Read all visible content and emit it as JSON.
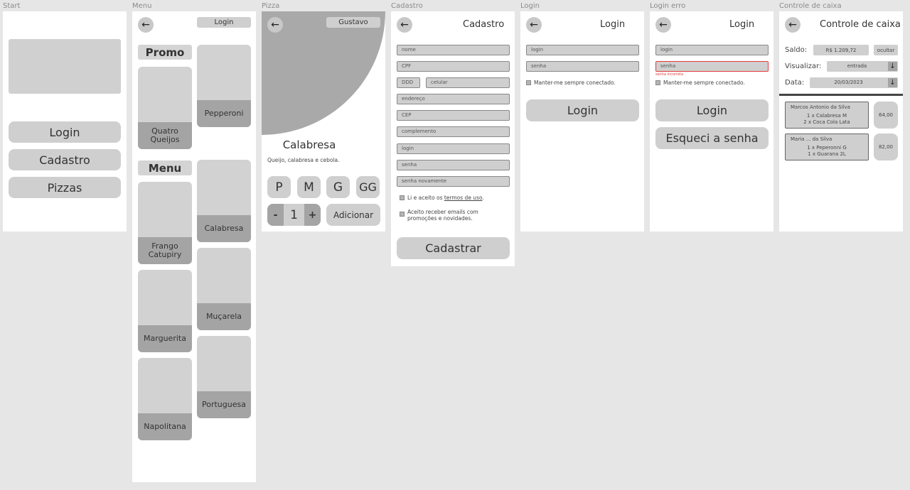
{
  "frames": {
    "start": {
      "title": "Start",
      "buttons": [
        "Login",
        "Cadastro",
        "Pizzas"
      ]
    },
    "menu": {
      "title": "Menu",
      "login_label": "Login",
      "promo_label": "Promo",
      "menu_label": "Menu",
      "pizzas": [
        "Quatro Queijos",
        "Pepperoni",
        "Frango Catupiry",
        "Calabresa",
        "Marguerita",
        "Muçarela",
        "Napolitana",
        "Portuguesa"
      ]
    },
    "pizza": {
      "title": "Pizza",
      "user_label": "Gustavo",
      "pizza_name": "Calabresa",
      "description": "Queijo, calabresa e cebola.",
      "sizes": [
        "P",
        "M",
        "G",
        "GG"
      ],
      "minus": "-",
      "quantity": "1",
      "plus": "+",
      "add_label": "Adicionar"
    },
    "cadastro": {
      "title": "Cadastro",
      "header": "Cadastro",
      "fields": {
        "nome": "nome",
        "cpf": "CPF",
        "ddd": "DDD",
        "celular": "celular",
        "endereco": "endereço",
        "cep": "CEP",
        "complemento": "complemento",
        "login": "login",
        "senha": "senha",
        "senha_novamente": "senha novamente"
      },
      "terms_prefix": "Li e aceito os ",
      "terms_link": "termos de uso",
      "terms_suffix": ".",
      "emails_line1": "Aceito receber emails com",
      "emails_line2": "promoções e novidades.",
      "submit": "Cadastrar"
    },
    "login": {
      "title": "Login",
      "header": "Login",
      "login_placeholder": "login",
      "senha_placeholder": "senha",
      "remember": "Manter-me sempre conectado.",
      "submit": "Login"
    },
    "login_erro": {
      "title": "Login erro",
      "header": "Login",
      "login_placeholder": "login",
      "senha_placeholder": "senha",
      "error_text": "senha incorreta",
      "remember": "Manter-me sempre conectado.",
      "submit": "Login",
      "forgot": "Esqueci a senha"
    },
    "caixa": {
      "title": "Controle de caixa",
      "header": "Controle de caixa",
      "saldo_label": "Saldo:",
      "saldo_value": "R$ 1.209,72",
      "ocultar": "ocultar",
      "visualizar_label": "Visualizar:",
      "visualizar_value": "entrada",
      "data_label": "Data:",
      "data_value": "20/03/2023",
      "orders": [
        {
          "name": "Marcos Antonio da Silva",
          "line1": "1 x Calabresa M",
          "line2": "2 x Coca Cola Lata",
          "value": "64,00"
        },
        {
          "name": "Maria ... da Silva",
          "line1": "1 x Peperonni G",
          "line2": "1 x Guarana 2L",
          "value": "82,00"
        }
      ]
    }
  },
  "colors": {
    "canvas": "#e6e6e6",
    "frame": "#ffffff",
    "button": "#cfcfcf",
    "error": "#e23b3b"
  }
}
